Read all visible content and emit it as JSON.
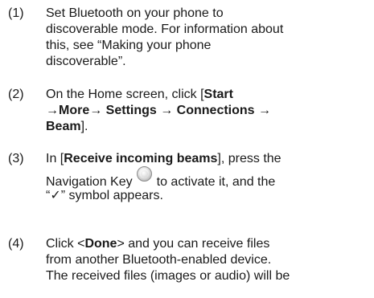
{
  "steps": [
    {
      "number": "(1)",
      "lines": [
        "Set Bluetooth on your phone to",
        "discoverable mode. For information about",
        "this, see “Making your phone",
        "discoverable”."
      ]
    },
    {
      "number": "(2)",
      "line1_pre": "On the Home screen, click [",
      "line1_bold": "Start",
      "line2_bold": "→More→ Settings → Connections →",
      "line3_bold": "Beam",
      "line3_post": "]."
    },
    {
      "number": "(3)",
      "line1_pre": "In [",
      "line1_bold": "Receive incoming beams",
      "line1_post": "], press the",
      "line2_pre": "Navigation Key",
      "line2_post": "to activate it, and the",
      "line3": "“✓” symbol appears.",
      "icon": "navigation-key-icon"
    },
    {
      "number": "(4)",
      "line1_pre": "Click <",
      "line1_bold": "Done",
      "line1_post": "> and you can receive files",
      "line2": "from another Bluetooth-enabled device.",
      "line3": "The received files (images or audio) will be"
    }
  ]
}
